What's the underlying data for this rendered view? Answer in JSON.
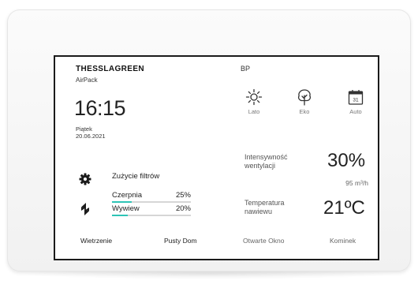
{
  "header": {
    "brand": "THESSLAGREEN",
    "model": "AirPack",
    "status": "BP"
  },
  "clock": {
    "time": "16:15",
    "day": "Piątek",
    "date": "20.06.2021"
  },
  "modes": [
    {
      "icon": "sun-icon",
      "label": "Lato"
    },
    {
      "icon": "eco-tree-icon",
      "label": "Eko"
    },
    {
      "icon": "calendar-icon",
      "label": "Auto",
      "calendar_day": "31"
    }
  ],
  "filters": {
    "title": "Zużycie filtrów",
    "items": [
      {
        "label": "Czerpnia",
        "value": "25%",
        "fraction": 0.25
      },
      {
        "label": "Wywiew",
        "value": "20%",
        "fraction": 0.2
      }
    ]
  },
  "ventilation": {
    "label_line1": "Intensywność",
    "label_line2": "wentylacji",
    "percent": "30%",
    "flow": "95 m³/h"
  },
  "temperature": {
    "label_line1": "Temperatura",
    "label_line2": "nawiewu",
    "value": "21ºC"
  },
  "actions": [
    {
      "label": "Wietrzenie"
    },
    {
      "label": "Pusty Dom"
    },
    {
      "label": "Otwarte Okno"
    },
    {
      "label": "Kominek"
    }
  ],
  "colors": {
    "accent": "#2ec4b6",
    "frame": "#1b1b1b",
    "text": "#222222",
    "muted": "#777777"
  }
}
